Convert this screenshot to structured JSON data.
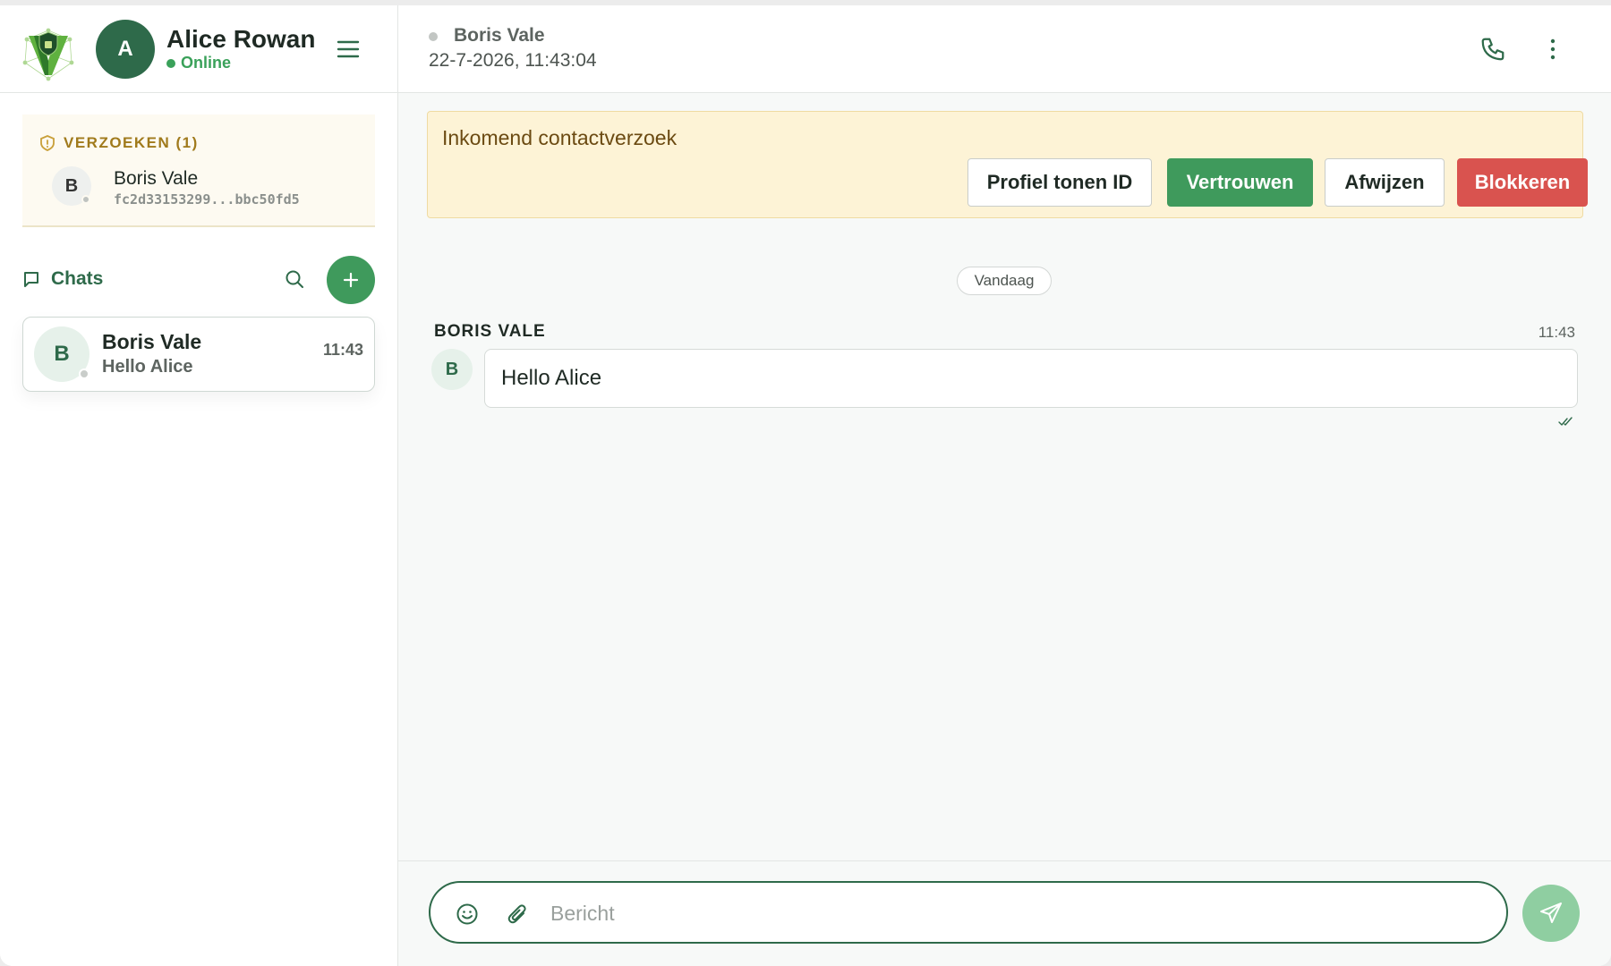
{
  "user": {
    "initial": "A",
    "name": "Alice Rowan",
    "status": "Online"
  },
  "requests": {
    "title": "VERZOEKEN (1)",
    "items": [
      {
        "initial": "B",
        "name": "Boris Vale",
        "id": "fc2d33153299...bbc50fd5"
      }
    ]
  },
  "chats": {
    "title": "Chats",
    "items": [
      {
        "initial": "B",
        "name": "Boris Vale",
        "preview": "Hello Alice",
        "time": "11:43"
      }
    ]
  },
  "conversation": {
    "peer_name": "Boris Vale",
    "peer_timestamp": "22-7-2026, 11:43:04"
  },
  "banner": {
    "title": "Inkomend contactverzoek",
    "buttons": {
      "profile": "Profiel tonen ID",
      "trust": "Vertrouwen",
      "reject": "Afwijzen",
      "block": "Blokkeren"
    }
  },
  "day_separator": "Vandaag",
  "messages": [
    {
      "sender": "BORIS VALE",
      "initial": "B",
      "time": "11:43",
      "text": "Hello Alice"
    }
  ],
  "composer": {
    "placeholder": "Bericht"
  },
  "colors": {
    "brand_green": "#2e6a4a",
    "accent_green": "#3f9a5c",
    "danger_red": "#d9534f",
    "warning_bg": "#fdf3d6"
  },
  "icons": [
    "logo-icon",
    "menu-icon",
    "shield-icon",
    "chat-bubble-icon",
    "search-icon",
    "plus-icon",
    "phone-icon",
    "more-vertical-icon",
    "double-check-icon",
    "emoji-icon",
    "paperclip-icon",
    "send-icon"
  ]
}
